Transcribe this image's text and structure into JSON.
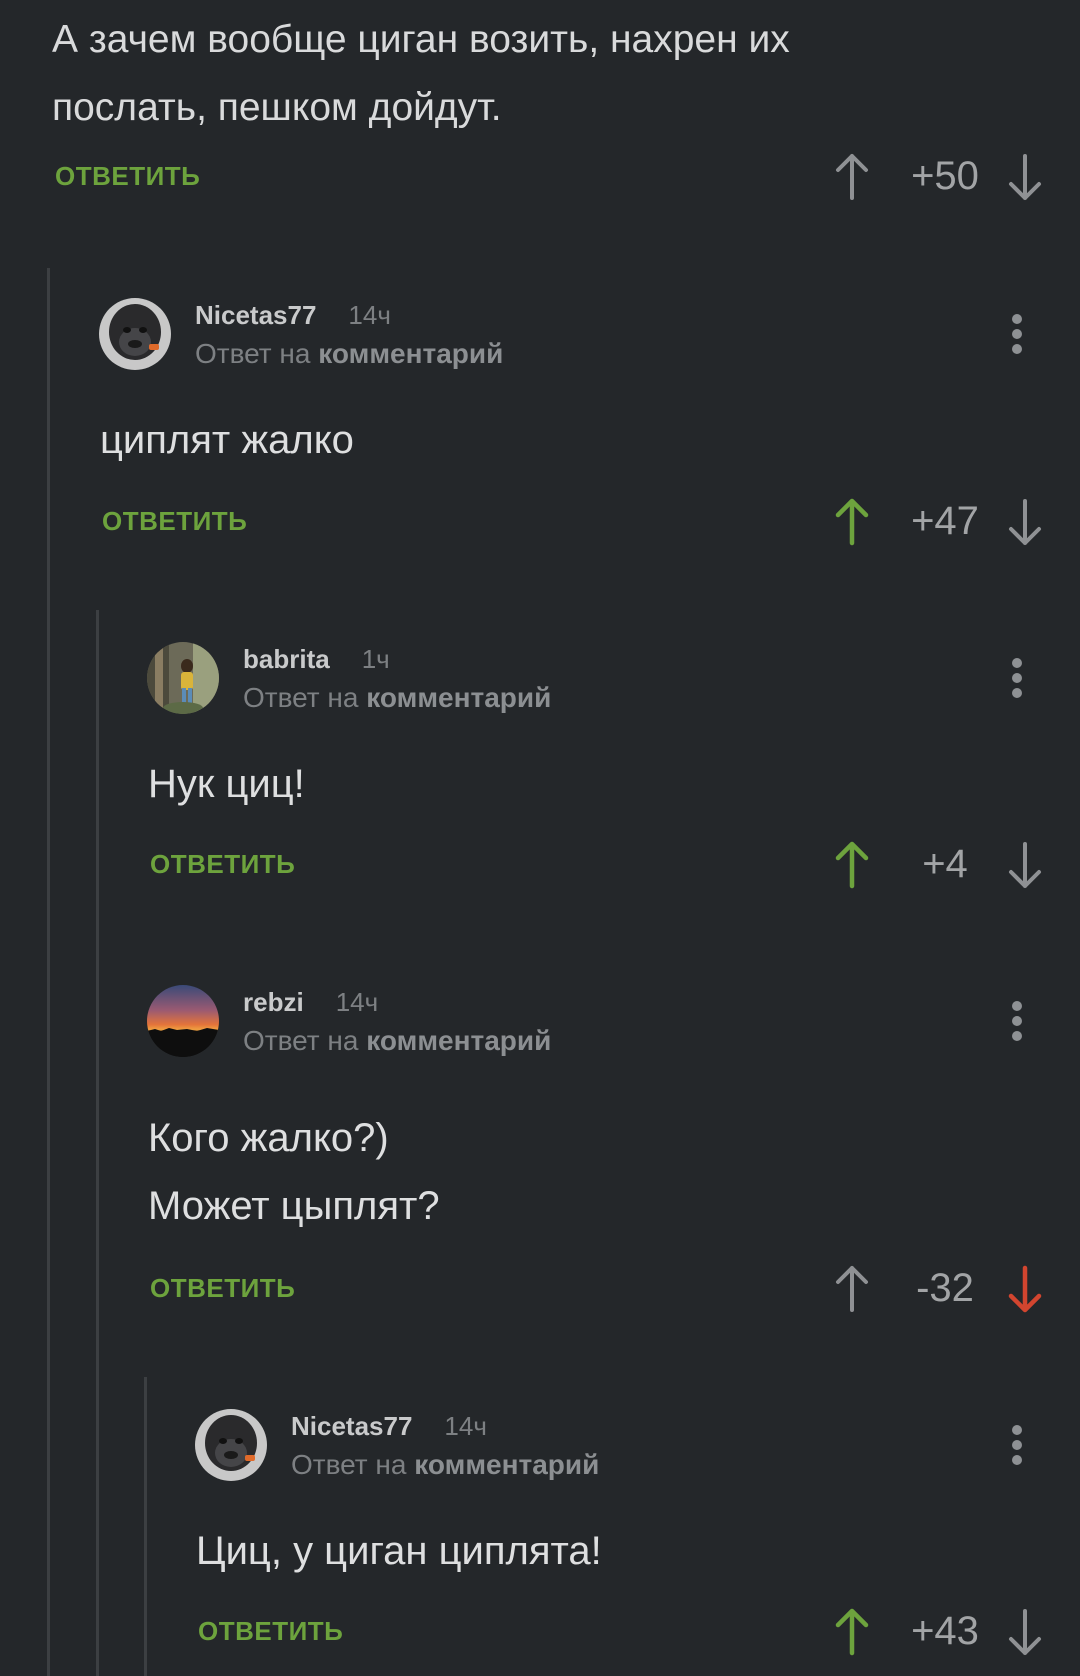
{
  "top_comment": {
    "text": "А зачем вообще циган возить, нахрен их послать, пешком дойдут.",
    "reply_label": "ОТВЕТИТЬ",
    "score": "+50"
  },
  "comments": [
    {
      "author": "Nicetas77",
      "time": "14ч",
      "reply_prefix": "Ответ на",
      "reply_link": "комментарий",
      "lines": [
        "циплят жалко"
      ],
      "reply_label": "ОТВЕТИТЬ",
      "score": "+47",
      "vote": "up",
      "avatar": "gorilla-avatar"
    },
    {
      "author": "babrita",
      "time": "1ч",
      "reply_prefix": "Ответ на",
      "reply_link": "комментарий",
      "lines": [
        "Нук циц!"
      ],
      "reply_label": "ОТВЕТИТЬ",
      "score": "+4",
      "vote": "up",
      "avatar": "forest-avatar"
    },
    {
      "author": "rebzi",
      "time": "14ч",
      "reply_prefix": "Ответ на",
      "reply_link": "комментарий",
      "lines": [
        "Кого жалко?)",
        "Может цыплят?"
      ],
      "reply_label": "ОТВЕТИТЬ",
      "score": "-32",
      "vote": "down",
      "avatar": "sunset-avatar"
    },
    {
      "author": "Nicetas77",
      "time": "14ч",
      "reply_prefix": "Ответ на",
      "reply_link": "комментарий",
      "lines": [
        "Циц, у циган циплята!"
      ],
      "reply_label": "ОТВЕТИТЬ",
      "score": "+43",
      "vote": "up",
      "avatar": "gorilla-avatar"
    }
  ],
  "colors": {
    "background": "#24272a",
    "reply_green": "#6da33d",
    "upvote_active": "#6da33d",
    "downvote_active": "#d2452f",
    "arrow_inactive": "#8f9194"
  }
}
